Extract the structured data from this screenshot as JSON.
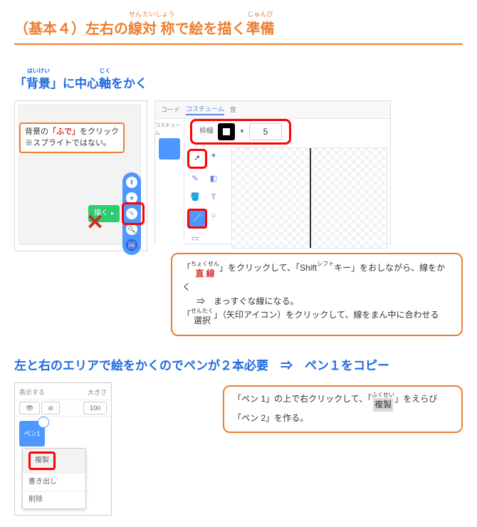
{
  "title": {
    "segments": [
      {
        "ruby": "",
        "base": "（基本４）"
      },
      {
        "ruby": "",
        "base": "左右の"
      },
      {
        "ruby": "せん",
        "base": "線"
      },
      {
        "ruby": "たいしょう",
        "base": "対 称"
      },
      {
        "ruby": "",
        "base": "で絵を描く"
      },
      {
        "ruby": "じゅんび",
        "base": "準備"
      }
    ]
  },
  "subtitle1": {
    "segments": [
      {
        "ruby": "",
        "base": "「"
      },
      {
        "ruby": "はいけい",
        "base": "背景"
      },
      {
        "ruby": "",
        "base": "」に中心"
      },
      {
        "ruby": "じく",
        "base": "軸"
      },
      {
        "ruby": "",
        "base": "をかく"
      }
    ]
  },
  "note1": {
    "line1_pre": "背景の",
    "line1_red": "「ふで」",
    "line1_post": "をクリック",
    "line2": "※スプライトではない。"
  },
  "draw_button": "描く",
  "editor": {
    "tabs": {
      "code": "コード",
      "costume": "コスチューム",
      "sound": "音"
    },
    "sidebar_label": "コスチューム",
    "stroke_label": "枠線",
    "stroke_width": "5"
  },
  "bubble1": {
    "line1": {
      "pre": "「",
      "red": "直 線",
      "ruby": "ちょくせん",
      "mid": "」をクリックして、「Shift",
      "kana": "シフト",
      "post": "キー」をおしながら、線をかく"
    },
    "line2": "⇒　まっすぐな線になる。",
    "line3": {
      "pre": "「",
      "word": "選択",
      "ruby": "せんたく",
      "post": "」（矢印アイコン）をクリックして、線をまん中に合わせる"
    }
  },
  "subtitle2": "左と右のエリアで絵をかくのでペンが２本必要　⇒　ペン１をコピー",
  "pen_panel": {
    "show": "表示する",
    "size": "大きさ",
    "size_val": "100",
    "sprite": "ペン1"
  },
  "context": {
    "duplicate": "複製",
    "export": "書き出し",
    "delete": "削除"
  },
  "bubble2": {
    "line1": {
      "pre": "「ペン 1」の上で右クリックして、「",
      "hi": "複製",
      "ruby": "ふくせい",
      "post": "」をえらび"
    },
    "line2": "「ペン 2」を作る。"
  }
}
